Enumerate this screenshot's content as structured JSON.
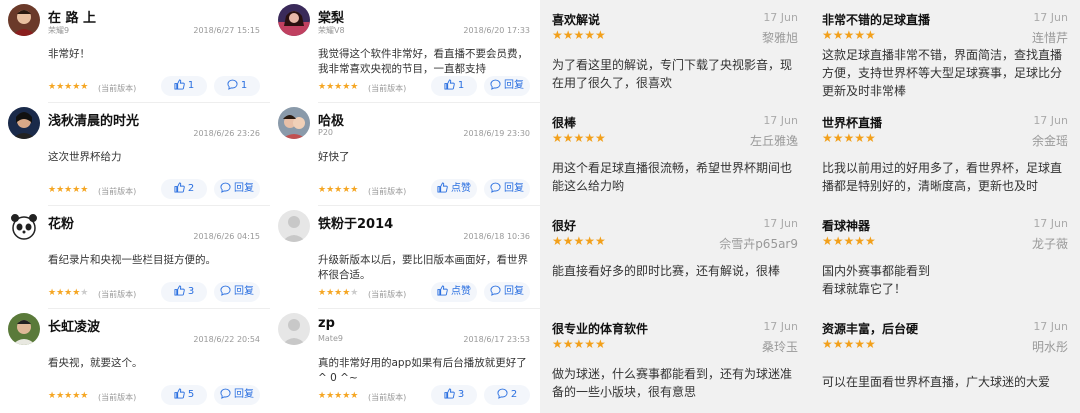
{
  "panel1": {
    "reviews": [
      {
        "user": "在 路 上",
        "device": "荣耀9",
        "date": "2018/6/27 15:15",
        "body": "非常好！",
        "stars": 5,
        "version": "(当前版本)",
        "btn1": "1",
        "btn2": "1",
        "btn1_icon": "thumb-up-icon",
        "btn2_icon": "comment-icon"
      },
      {
        "user": "浅秋清晨的时光",
        "device": "",
        "date": "2018/6/26 23:26",
        "body": "这次世界杯给力",
        "stars": 5,
        "version": "(当前版本)",
        "btn1": "2",
        "btn2": "回复",
        "btn1_icon": "thumb-up-icon",
        "btn2_icon": "comment-icon"
      },
      {
        "user": "花粉",
        "device": "",
        "date": "2018/6/26 04:15",
        "body": "看纪录片和央视一些栏目挺方便的。",
        "stars": 4,
        "version": "(当前版本)",
        "btn1": "3",
        "btn2": "回复",
        "btn1_icon": "thumb-up-icon",
        "btn2_icon": "comment-icon"
      },
      {
        "user": "长虹凌波",
        "device": "",
        "date": "2018/6/22 20:54",
        "body": "看央视，就要这个。",
        "stars": 5,
        "version": "(当前版本)",
        "btn1": "5",
        "btn2": "回复",
        "btn1_icon": "thumb-up-icon",
        "btn2_icon": "comment-icon"
      }
    ]
  },
  "panel2": {
    "reviews": [
      {
        "user": "棠梨",
        "device": "荣耀V8",
        "date": "2018/6/20 17:33",
        "body": "我觉得这个软件非常好，看直播不要会员费，我非常喜欢央视的节目，一直都支持",
        "stars": 5,
        "version": "(当前版本)",
        "btn1": "1",
        "btn2": "回复",
        "btn1_icon": "thumb-up-icon",
        "btn2_icon": "comment-icon"
      },
      {
        "user": "哈极",
        "device": "P20",
        "date": "2018/6/19 23:30",
        "body": "好快了",
        "stars": 5,
        "version": "(当前版本)",
        "btn1": "点赞",
        "btn2": "回复",
        "btn1_icon": "thumb-up-icon",
        "btn2_icon": "comment-icon"
      },
      {
        "user": "铁粉于2014",
        "device": "",
        "date": "2018/6/18 10:36",
        "body": "升级新版本以后，要比旧版本画面好，看世界杯很合适。",
        "stars": 4,
        "version": "(当前版本)",
        "btn1": "点赞",
        "btn2": "回复",
        "btn1_icon": "thumb-up-icon",
        "btn2_icon": "comment-icon"
      },
      {
        "user": "zp",
        "device": "Mate9",
        "date": "2018/6/17 23:53",
        "body": "真的非常好用的app如果有后台播放就更好了 ^ 0 ^~",
        "stars": 5,
        "version": "(当前版本)",
        "btn1": "3",
        "btn2": "2",
        "btn1_icon": "thumb-up-icon",
        "btn2_icon": "comment-icon"
      }
    ]
  },
  "panel3": {
    "reviews": [
      {
        "title": "喜欢解说",
        "date": "17 Jun",
        "stars": 5,
        "author": "黎雅旭",
        "body": "为了看这里的解说，专门下载了央视影音，现在用了很久了，很喜欢"
      },
      {
        "title": "很棒",
        "date": "17 Jun",
        "stars": 5,
        "author": "左丘雅逸",
        "body": "用这个看足球直播很流畅，希望世界杯期间也能这么给力哟"
      },
      {
        "title": "很好",
        "date": "17 Jun",
        "stars": 5,
        "author": "佘雪卉p65ar9",
        "body": "能直接看好多的即时比赛，还有解说，很棒"
      },
      {
        "title": "很专业的体育软件",
        "date": "17 Jun",
        "stars": 5,
        "author": "桑玲玉",
        "body": "做为球迷，什么赛事都能看到，还有为球迷准备的一些小版块，很有意思"
      }
    ]
  },
  "panel4": {
    "reviews": [
      {
        "title": "非常不错的足球直播",
        "date": "17 Jun",
        "stars": 5,
        "author": "连惜芹",
        "body": "这款足球直播非常不错，界面简洁，查找直播方便，支持世界杯等大型足球赛事，足球比分更新及时非常棒"
      },
      {
        "title": "世界杯直播",
        "date": "17 Jun",
        "stars": 5,
        "author": "余金瑶",
        "body": "比我以前用过的好用多了，看世界杯，足球直播都是特别好的，清晰度高，更新也及时"
      },
      {
        "title": "看球神器",
        "date": "17 Jun",
        "stars": 5,
        "author": "龙子薇",
        "body": "国内外赛事都能看到\n 看球就靠它了！"
      },
      {
        "title": "资源丰富，后台硬",
        "date": "17 Jun",
        "stars": 5,
        "author": "明水彤",
        "body": "可以在里面看世界杯直播，广大球迷的大爱"
      }
    ]
  },
  "colors": {
    "star": "#f5a623",
    "accent": "#2a6fe0",
    "gp_bg": "#f1f1f1"
  }
}
